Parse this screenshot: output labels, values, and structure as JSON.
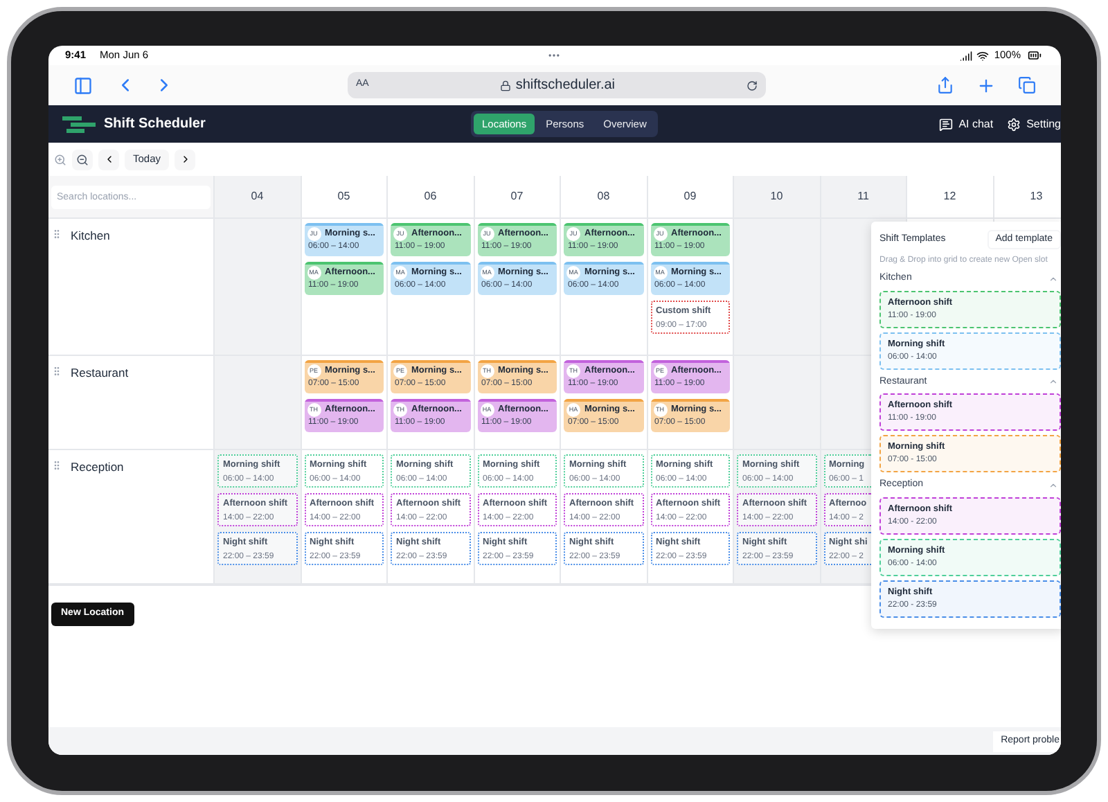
{
  "status_bar": {
    "time": "9:41",
    "date": "Mon Jun 6",
    "battery": "100%"
  },
  "browser": {
    "text_size": "AA",
    "url": "shiftscheduler.ai"
  },
  "app": {
    "title": "Shift Scheduler",
    "tabs": [
      {
        "label": "Locations",
        "selected": true
      },
      {
        "label": "Persons",
        "selected": false
      },
      {
        "label": "Overview",
        "selected": false
      }
    ],
    "actions": [
      {
        "label": "AI chat",
        "kind": "chat"
      },
      {
        "label": "Setting",
        "kind": "settings"
      }
    ]
  },
  "toolbar": {
    "today": "Today"
  },
  "grid": {
    "search_placeholder": "Search locations...",
    "days": [
      {
        "label": "04",
        "shaded": true
      },
      {
        "label": "05",
        "shaded": false
      },
      {
        "label": "06",
        "shaded": false
      },
      {
        "label": "07",
        "shaded": false
      },
      {
        "label": "08",
        "shaded": false
      },
      {
        "label": "09",
        "shaded": false
      },
      {
        "label": "10",
        "shaded": true
      },
      {
        "label": "11",
        "shaded": true
      },
      {
        "label": "12",
        "shaded": false
      },
      {
        "label": "13",
        "shaded": false
      }
    ],
    "rows": [
      {
        "name": "Kitchen",
        "cells": [
          {},
          {
            "shifts": [
              {
                "kind": "assigned",
                "initials": "JU",
                "title": "Morning s...",
                "time": "06:00 – 14:00",
                "color": "#7cc0f0"
              },
              {
                "kind": "assigned",
                "initials": "MA",
                "title": "Afternoon...",
                "time": "11:00 – 19:00",
                "color": "#4cc470"
              }
            ]
          },
          {
            "shifts": [
              {
                "kind": "assigned",
                "initials": "JU",
                "title": "Afternoon...",
                "time": "11:00 – 19:00",
                "color": "#4cc470"
              },
              {
                "kind": "assigned",
                "initials": "MA",
                "title": "Morning s...",
                "time": "06:00 – 14:00",
                "color": "#7cc0f0"
              }
            ]
          },
          {
            "shifts": [
              {
                "kind": "assigned",
                "initials": "JU",
                "title": "Afternoon...",
                "time": "11:00 – 19:00",
                "color": "#4cc470"
              },
              {
                "kind": "assigned",
                "initials": "MA",
                "title": "Morning s...",
                "time": "06:00 – 14:00",
                "color": "#7cc0f0"
              }
            ]
          },
          {
            "shifts": [
              {
                "kind": "assigned",
                "initials": "JU",
                "title": "Afternoon...",
                "time": "11:00 – 19:00",
                "color": "#4cc470"
              },
              {
                "kind": "assigned",
                "initials": "MA",
                "title": "Morning s...",
                "time": "06:00 – 14:00",
                "color": "#7cc0f0"
              }
            ]
          },
          {
            "shifts": [
              {
                "kind": "assigned",
                "initials": "JU",
                "title": "Afternoon...",
                "time": "11:00 – 19:00",
                "color": "#4cc470"
              },
              {
                "kind": "assigned",
                "initials": "MA",
                "title": "Morning s...",
                "time": "06:00 – 14:00",
                "color": "#7cc0f0"
              },
              {
                "kind": "open",
                "title": "Custom shift",
                "time": "09:00 – 17:00",
                "color": "#e04848"
              }
            ]
          },
          {},
          {},
          {},
          {}
        ]
      },
      {
        "name": "Restaurant",
        "cells": [
          {},
          {
            "shifts": [
              {
                "kind": "assigned",
                "initials": "PE",
                "title": "Morning s...",
                "time": "07:00 – 15:00",
                "color": "#f2a444"
              },
              {
                "kind": "assigned",
                "initials": "TH",
                "title": "Afternoon...",
                "time": "11:00 – 19:00",
                "color": "#c262dc"
              }
            ]
          },
          {
            "shifts": [
              {
                "kind": "assigned",
                "initials": "PE",
                "title": "Morning s...",
                "time": "07:00 – 15:00",
                "color": "#f2a444"
              },
              {
                "kind": "assigned",
                "initials": "TH",
                "title": "Afternoon...",
                "time": "11:00 – 19:00",
                "color": "#c262dc"
              }
            ]
          },
          {
            "shifts": [
              {
                "kind": "assigned",
                "initials": "TH",
                "title": "Morning s...",
                "time": "07:00 – 15:00",
                "color": "#f2a444"
              },
              {
                "kind": "assigned",
                "initials": "HA",
                "title": "Afternoon...",
                "time": "11:00 – 19:00",
                "color": "#c262dc"
              }
            ]
          },
          {
            "shifts": [
              {
                "kind": "assigned",
                "initials": "TH",
                "title": "Afternoon...",
                "time": "11:00 – 19:00",
                "color": "#c262dc"
              },
              {
                "kind": "assigned",
                "initials": "HA",
                "title": "Morning s...",
                "time": "07:00 – 15:00",
                "color": "#f2a444"
              }
            ]
          },
          {
            "shifts": [
              {
                "kind": "assigned",
                "initials": "PE",
                "title": "Afternoon...",
                "time": "11:00 – 19:00",
                "color": "#c262dc"
              },
              {
                "kind": "assigned",
                "initials": "TH",
                "title": "Morning s...",
                "time": "07:00 – 15:00",
                "color": "#f2a444"
              }
            ]
          },
          {},
          {},
          {},
          {}
        ]
      },
      {
        "name": "Reception",
        "cells": [
          {
            "shifts": [
              {
                "kind": "open",
                "title": "Morning shift",
                "time": "06:00 – 14:00",
                "color": "#4fcf9a"
              },
              {
                "kind": "open",
                "title": "Afternoon shift",
                "time": "14:00 – 22:00",
                "color": "#c040d8"
              },
              {
                "kind": "open",
                "title": "Night shift",
                "time": "22:00 – 23:59",
                "color": "#4a8ee8"
              }
            ]
          },
          {
            "shifts": [
              {
                "kind": "open",
                "title": "Morning shift",
                "time": "06:00 – 14:00",
                "color": "#4fcf9a"
              },
              {
                "kind": "open",
                "title": "Afternoon shift",
                "time": "14:00 – 22:00",
                "color": "#c040d8"
              },
              {
                "kind": "open",
                "title": "Night shift",
                "time": "22:00 – 23:59",
                "color": "#4a8ee8"
              }
            ]
          },
          {
            "shifts": [
              {
                "kind": "open",
                "title": "Morning shift",
                "time": "06:00 – 14:00",
                "color": "#4fcf9a"
              },
              {
                "kind": "open",
                "title": "Afternoon shift",
                "time": "14:00 – 22:00",
                "color": "#c040d8"
              },
              {
                "kind": "open",
                "title": "Night shift",
                "time": "22:00 – 23:59",
                "color": "#4a8ee8"
              }
            ]
          },
          {
            "shifts": [
              {
                "kind": "open",
                "title": "Morning shift",
                "time": "06:00 – 14:00",
                "color": "#4fcf9a"
              },
              {
                "kind": "open",
                "title": "Afternoon shift",
                "time": "14:00 – 22:00",
                "color": "#c040d8"
              },
              {
                "kind": "open",
                "title": "Night shift",
                "time": "22:00 – 23:59",
                "color": "#4a8ee8"
              }
            ]
          },
          {
            "shifts": [
              {
                "kind": "open",
                "title": "Morning shift",
                "time": "06:00 – 14:00",
                "color": "#4fcf9a"
              },
              {
                "kind": "open",
                "title": "Afternoon shift",
                "time": "14:00 – 22:00",
                "color": "#c040d8"
              },
              {
                "kind": "open",
                "title": "Night shift",
                "time": "22:00 – 23:59",
                "color": "#4a8ee8"
              }
            ]
          },
          {
            "shifts": [
              {
                "kind": "open",
                "title": "Morning shift",
                "time": "06:00 – 14:00",
                "color": "#4fcf9a"
              },
              {
                "kind": "open",
                "title": "Afternoon shift",
                "time": "14:00 – 22:00",
                "color": "#c040d8"
              },
              {
                "kind": "open",
                "title": "Night shift",
                "time": "22:00 – 23:59",
                "color": "#4a8ee8"
              }
            ]
          },
          {
            "shifts": [
              {
                "kind": "open",
                "title": "Morning shift",
                "time": "06:00 – 14:00",
                "color": "#4fcf9a"
              },
              {
                "kind": "open",
                "title": "Afternoon shift",
                "time": "14:00 – 22:00",
                "color": "#c040d8"
              },
              {
                "kind": "open",
                "title": "Night shift",
                "time": "22:00 – 23:59",
                "color": "#4a8ee8"
              }
            ]
          },
          {
            "cut_off": true,
            "shifts": [
              {
                "kind": "open",
                "title": "Morning",
                "time": "06:00 – 1",
                "color": "#4fcf9a"
              },
              {
                "kind": "open",
                "title": "Afternoo",
                "time": "14:00 – 2",
                "color": "#c040d8"
              },
              {
                "kind": "open",
                "title": "Night shi",
                "time": "22:00 – 2",
                "color": "#4a8ee8"
              }
            ]
          },
          {},
          {}
        ]
      }
    ]
  },
  "new_location": "New Location",
  "templates": {
    "title": "Shift Templates",
    "add": "Add template",
    "hint": "Drag & Drop into grid to create new Open slot",
    "groups": [
      {
        "name": "Kitchen",
        "expanded": true,
        "items": [
          {
            "title": "Afternoon shift",
            "time": "11:00 - 19:00",
            "color": "#4cc470"
          },
          {
            "title": "Morning shift",
            "time": "06:00 - 14:00",
            "color": "#7cc0f0"
          }
        ]
      },
      {
        "name": "Restaurant",
        "expanded": true,
        "items": [
          {
            "title": "Afternoon shift",
            "time": "11:00 - 19:00",
            "color": "#c040d8"
          },
          {
            "title": "Morning shift",
            "time": "07:00 - 15:00",
            "color": "#f2a444"
          }
        ]
      },
      {
        "name": "Reception",
        "expanded": true,
        "items": [
          {
            "title": "Afternoon shift",
            "time": "14:00 - 22:00",
            "color": "#c040d8"
          },
          {
            "title": "Morning shift",
            "time": "06:00 - 14:00",
            "color": "#4fcf9a"
          },
          {
            "title": "Night shift",
            "time": "22:00 - 23:59",
            "color": "#4a8ee8"
          }
        ]
      }
    ]
  },
  "footer": {
    "report": "Report proble"
  }
}
